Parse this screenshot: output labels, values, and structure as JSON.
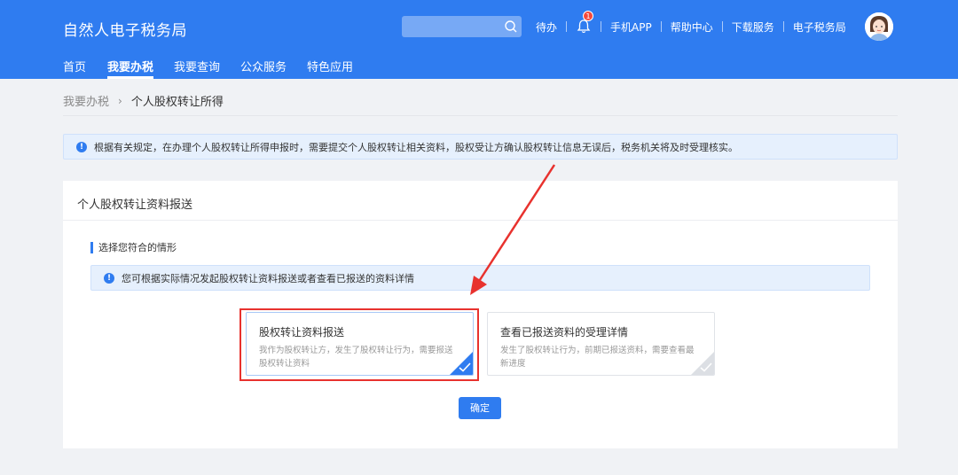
{
  "header": {
    "title": "自然人电子税务局",
    "search": {
      "placeholder": "",
      "icon": "search-icon"
    },
    "links": {
      "todo": "待办",
      "notification_count": "1",
      "mobile_app": "手机APP",
      "help_center": "帮助中心",
      "download": "下载服务",
      "e_tax": "电子税务局"
    },
    "brand_color": "#2f7cf0"
  },
  "nav": {
    "items": [
      {
        "label": "首页",
        "active": false
      },
      {
        "label": "我要办税",
        "active": true
      },
      {
        "label": "我要查询",
        "active": false
      },
      {
        "label": "公众服务",
        "active": false
      },
      {
        "label": "特色应用",
        "active": false
      }
    ]
  },
  "breadcrumb": {
    "parent": "我要办税",
    "current": "个人股权转让所得"
  },
  "notice": {
    "text": "根据有关规定，在办理个人股权转让所得申报时，需要提交个人股权转让相关资料，股权受让方确认股权转让信息无误后，税务机关将及时受理核实。"
  },
  "card": {
    "title": "个人股权转让资料报送",
    "section_label": "选择您符合的情形",
    "tip": "您可根据实际情况发起股权转让资料报送或者查看已报送的资料详情",
    "options": [
      {
        "title": "股权转让资料报送",
        "desc": "我作为股权转让方，发生了股权转让行为，需要报送股权转让资料",
        "selected": true
      },
      {
        "title": "查看已报送资料的受理详情",
        "desc": "发生了股权转让行为，前期已报送资料，需要查看最新进度",
        "selected": false
      }
    ],
    "confirm_label": "确定"
  },
  "annotation_color": "#e8322e"
}
